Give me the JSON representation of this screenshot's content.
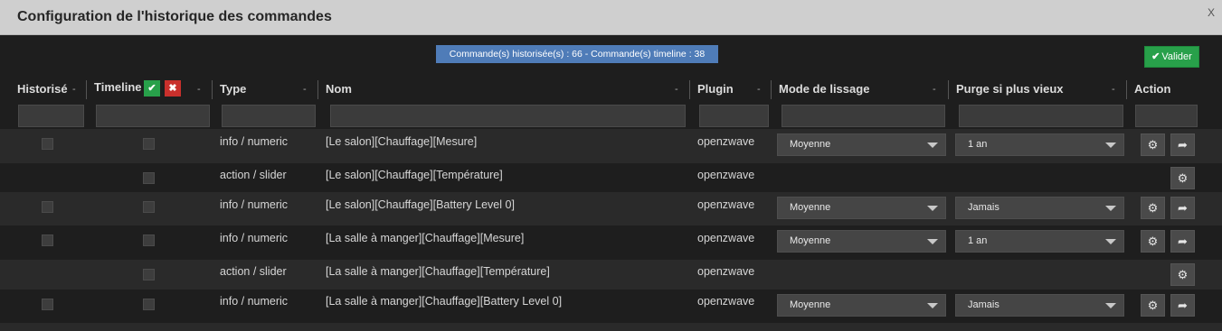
{
  "window": {
    "title": "Configuration de l'historique des commandes",
    "close_label": "X"
  },
  "stats_badge": "Commande(s) historisée(s) : 66 - Commande(s) timeline : 38",
  "validate_button": {
    "icon": "check-icon",
    "label": "Valider"
  },
  "columns": {
    "historise": "Historisé",
    "timeline": "Timeline",
    "type": "Type",
    "nom": "Nom",
    "plugin": "Plugin",
    "lissage": "Mode de lissage",
    "purge": "Purge si plus vieux",
    "action": "Action",
    "sort_marker": "-"
  },
  "timeline_header_buttons": {
    "select_all": "✔",
    "deselect_all": "✖"
  },
  "icons": {
    "config": "gears-icon",
    "goto": "share-arrow-icon"
  },
  "rows": [
    {
      "type": "info / numeric",
      "nom": "[Le salon][Chauffage][Mesure]",
      "plugin": "openzwave",
      "lissage": "Moyenne",
      "purge": "1 an"
    },
    {
      "type": "action / slider",
      "nom": "[Le salon][Chauffage][Température]",
      "plugin": "openzwave"
    },
    {
      "type": "info / numeric",
      "nom": "[Le salon][Chauffage][Battery Level 0]",
      "plugin": "openzwave",
      "lissage": "Moyenne",
      "purge": "Jamais"
    },
    {
      "type": "info / numeric",
      "nom": "[La salle à manger][Chauffage][Mesure]",
      "plugin": "openzwave",
      "lissage": "Moyenne",
      "purge": "1 an"
    },
    {
      "type": "action / slider",
      "nom": "[La salle à manger][Chauffage][Température]",
      "plugin": "openzwave"
    },
    {
      "type": "info / numeric",
      "nom": "[La salle à manger][Chauffage][Battery Level 0]",
      "plugin": "openzwave",
      "lissage": "Moyenne",
      "purge": "Jamais"
    }
  ]
}
